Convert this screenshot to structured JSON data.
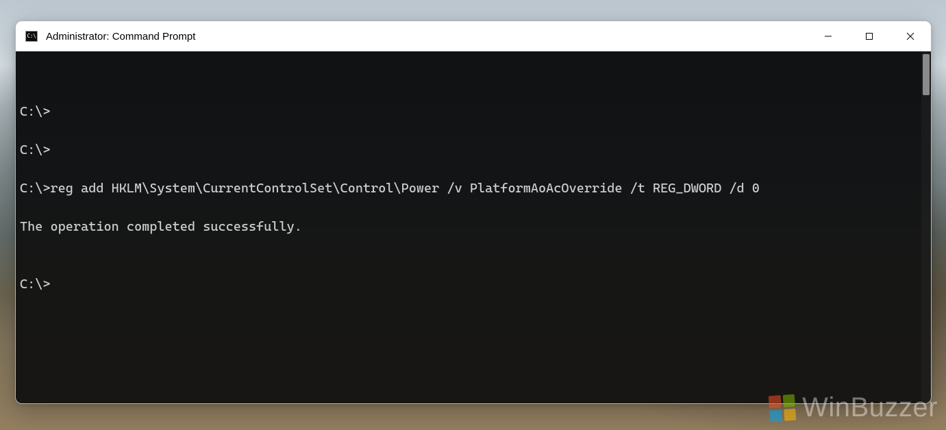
{
  "window": {
    "title": "Administrator: Command Prompt"
  },
  "terminal": {
    "lines": {
      "l0": "",
      "l1": "C:\\>",
      "l2": "C:\\>",
      "l3": "C:\\>reg add HKLM\\System\\CurrentControlSet\\Control\\Power /v PlatformAoAcOverride /t REG_DWORD /d 0",
      "l4": "The operation completed successfully.",
      "l5": "",
      "l6": "C:\\>"
    }
  },
  "watermark": {
    "text": "WinBuzzer"
  }
}
